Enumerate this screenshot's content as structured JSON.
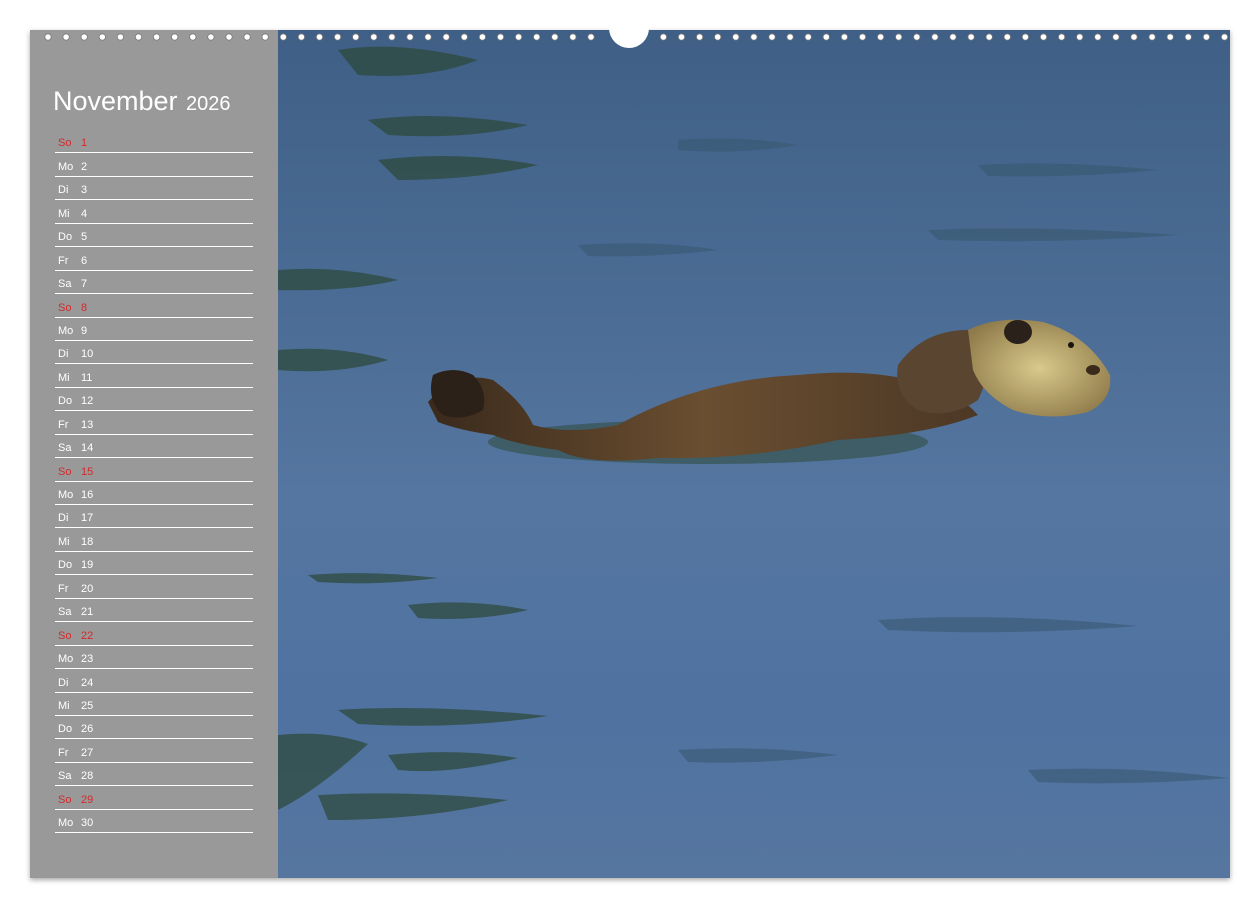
{
  "calendar": {
    "month": "November",
    "year": "2026",
    "days": [
      {
        "dow": "So",
        "day": "1",
        "sunday": true
      },
      {
        "dow": "Mo",
        "day": "2"
      },
      {
        "dow": "Di",
        "day": "3"
      },
      {
        "dow": "Mi",
        "day": "4"
      },
      {
        "dow": "Do",
        "day": "5"
      },
      {
        "dow": "Fr",
        "day": "6"
      },
      {
        "dow": "Sa",
        "day": "7"
      },
      {
        "dow": "So",
        "day": "8",
        "sunday": true
      },
      {
        "dow": "Mo",
        "day": "9"
      },
      {
        "dow": "Di",
        "day": "10"
      },
      {
        "dow": "Mi",
        "day": "11"
      },
      {
        "dow": "Do",
        "day": "12"
      },
      {
        "dow": "Fr",
        "day": "13"
      },
      {
        "dow": "Sa",
        "day": "14"
      },
      {
        "dow": "So",
        "day": "15",
        "sunday": true
      },
      {
        "dow": "Mo",
        "day": "16"
      },
      {
        "dow": "Di",
        "day": "17"
      },
      {
        "dow": "Mi",
        "day": "18"
      },
      {
        "dow": "Do",
        "day": "19"
      },
      {
        "dow": "Fr",
        "day": "20"
      },
      {
        "dow": "Sa",
        "day": "21"
      },
      {
        "dow": "So",
        "day": "22",
        "sunday": true
      },
      {
        "dow": "Mo",
        "day": "23"
      },
      {
        "dow": "Di",
        "day": "24"
      },
      {
        "dow": "Mi",
        "day": "25"
      },
      {
        "dow": "Do",
        "day": "26"
      },
      {
        "dow": "Fr",
        "day": "27"
      },
      {
        "dow": "Sa",
        "day": "28"
      },
      {
        "dow": "So",
        "day": "29",
        "sunday": true
      },
      {
        "dow": "Mo",
        "day": "30"
      }
    ]
  },
  "colors": {
    "sidebar": "#999999",
    "sunday": "#d22a2a",
    "text": "#ffffff",
    "water": "#4f72a1"
  },
  "photo": {
    "subject_icon": "sea-otter-photo"
  }
}
